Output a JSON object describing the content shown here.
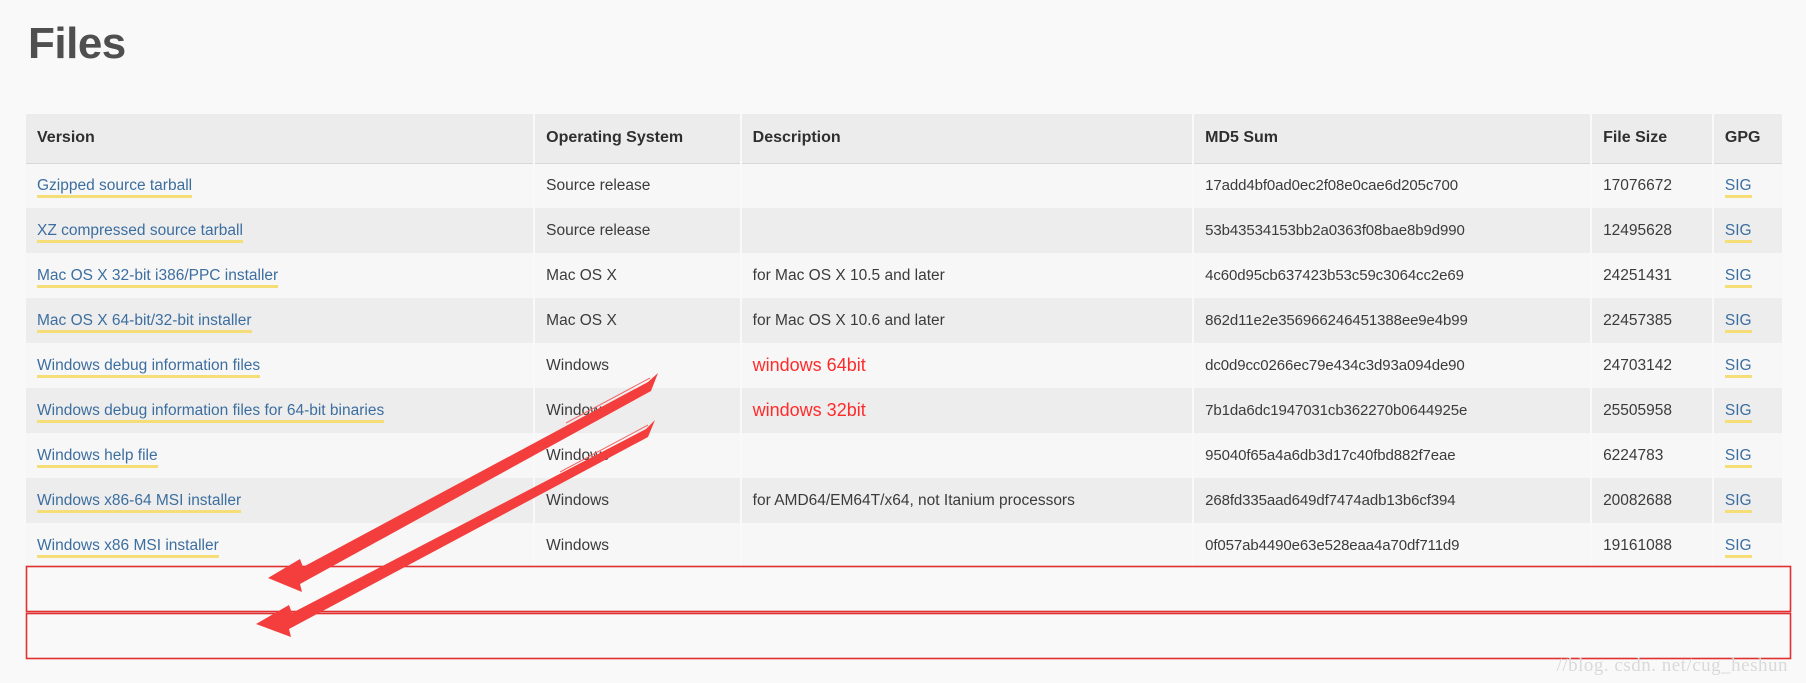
{
  "page": {
    "title": "Files",
    "watermark": "//blog. csdn. net/cug_heshun"
  },
  "table": {
    "columns": [
      {
        "key": "version",
        "label": "Version"
      },
      {
        "key": "os",
        "label": "Operating System"
      },
      {
        "key": "description",
        "label": "Description"
      },
      {
        "key": "md5",
        "label": "MD5 Sum"
      },
      {
        "key": "size",
        "label": "File Size"
      },
      {
        "key": "gpg",
        "label": "GPG"
      }
    ],
    "rows": [
      {
        "version": "Gzipped source tarball",
        "os": "Source release",
        "description": "",
        "md5": "17add4bf0ad0ec2f08e0cae6d205c700",
        "size": "17076672",
        "gpg": "SIG",
        "highlighted": false
      },
      {
        "version": "XZ compressed source tarball",
        "os": "Source release",
        "description": "",
        "md5": "53b43534153bb2a0363f08bae8b9d990",
        "size": "12495628",
        "gpg": "SIG",
        "highlighted": false
      },
      {
        "version": "Mac OS X 32-bit i386/PPC installer",
        "os": "Mac OS X",
        "description": "for Mac OS X 10.5 and later",
        "md5": "4c60d95cb637423b53c59c3064cc2e69",
        "size": "24251431",
        "gpg": "SIG",
        "highlighted": false
      },
      {
        "version": "Mac OS X 64-bit/32-bit installer",
        "os": "Mac OS X",
        "description": "for Mac OS X 10.6 and later",
        "md5": "862d11e2e356966246451388ee9e4b99",
        "size": "22457385",
        "gpg": "SIG",
        "highlighted": false
      },
      {
        "version": "Windows debug information files",
        "os": "Windows",
        "description": "",
        "md5": "dc0d9cc0266ec79e434c3d93a094de90",
        "size": "24703142",
        "gpg": "SIG",
        "highlighted": false
      },
      {
        "version": "Windows debug information files for 64-bit binaries",
        "os": "Windows",
        "description": "",
        "md5": "7b1da6dc1947031cb362270b0644925e",
        "size": "25505958",
        "gpg": "SIG",
        "highlighted": false
      },
      {
        "version": "Windows help file",
        "os": "Windows",
        "description": "",
        "md5": "95040f65a4a6db3d17c40fbd882f7eae",
        "size": "6224783",
        "gpg": "SIG",
        "highlighted": false
      },
      {
        "version": "Windows x86-64 MSI installer",
        "os": "Windows",
        "description": "for AMD64/EM64T/x64, not Itanium processors",
        "md5": "268fd335aad649df7474adb13b6cf394",
        "size": "20082688",
        "gpg": "SIG",
        "highlighted": true
      },
      {
        "version": "Windows x86 MSI installer",
        "os": "Windows",
        "description": "",
        "md5": "0f057ab4490e63e528eaa4a70df711d9",
        "size": "19161088",
        "gpg": "SIG",
        "highlighted": true
      }
    ]
  },
  "annotations": {
    "color": "#ff2b2b",
    "labels": [
      {
        "text": "windows 64bit",
        "target_row_version": "Windows x86-64 MSI installer"
      },
      {
        "text": "windows 32bit",
        "target_row_version": "Windows x86 MSI installer"
      }
    ]
  }
}
